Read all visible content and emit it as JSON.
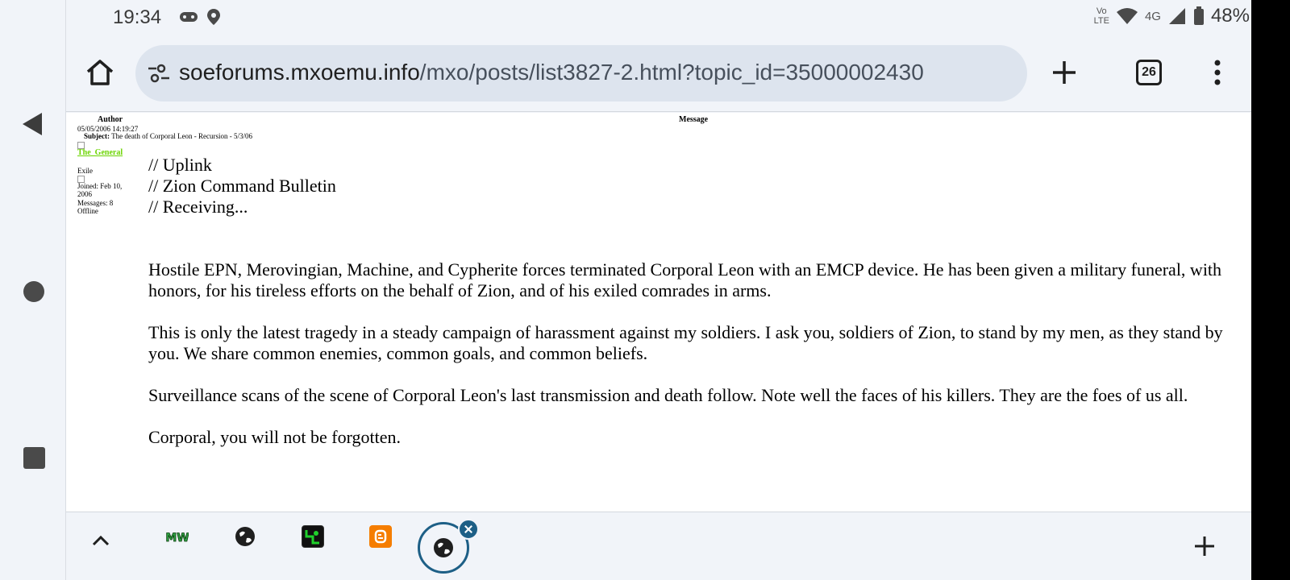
{
  "status_bar": {
    "time": "19:34",
    "volte_line1": "Vo",
    "volte_line2": "LTE",
    "network": "4G",
    "battery": "48%"
  },
  "toolbar": {
    "url_domain": "soeforums.mxoemu.info",
    "url_path": "/mxo/posts/list3827-2.html?topic_id=35000002430",
    "tab_count": "26"
  },
  "page": {
    "header_author": "Author",
    "header_message": "Message",
    "post_date": "05/05/2006 14:19:27",
    "subject_label": "Subject:",
    "subject_text": "The death of Corporal Leon - Recursion - 5/3/06",
    "username": "The_General",
    "user_rank": "Exile",
    "user_joined": "Joined: Feb 10, 2006",
    "user_messages": "Messages: 8",
    "user_status": "Offline",
    "body_lines": [
      "// Uplink",
      "// Zion Command Bulletin",
      "// Receiving..."
    ],
    "paragraphs": [
      "Hostile EPN, Merovingian, Machine, and Cypherite forces terminated Corporal Leon with an EMCP device. He has been given a military funeral, with honors, for his tireless efforts on the behalf of Zion, and of his exiled comrades in arms.",
      "This is only the latest tragedy in a steady campaign of harassment against my soldiers. I ask you, soldiers of Zion, to stand by my men, as they stand by you. We share common enemies, common goals, and common beliefs.",
      "Surveillance scans of the scene of Corporal Leon's last transmission and death follow. Note well the faces of his killers. They are the foes of us all.",
      "Corporal, you will not be forgotten."
    ]
  },
  "tab_strip": {
    "favicons": [
      "mxo-icon",
      "globe-icon",
      "matrix-icon",
      "blogger-icon"
    ],
    "active_favicon": "globe-icon"
  },
  "colors": {
    "background": "#f1f4f9",
    "urlbar": "#dde4ee",
    "username_link": "#6bd400",
    "active_tab_ring": "#1d5f86",
    "blogger": "#f57d00"
  }
}
